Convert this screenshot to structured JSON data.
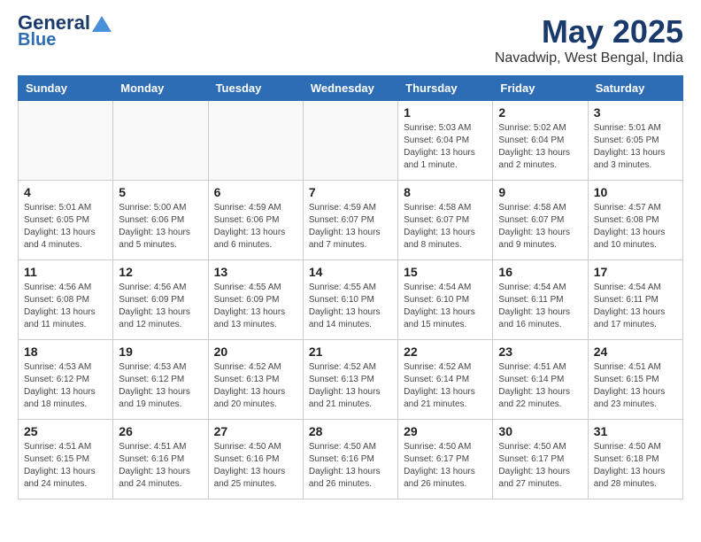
{
  "header": {
    "logo_general": "General",
    "logo_blue": "Blue",
    "month_title": "May 2025",
    "location": "Navadwip, West Bengal, India"
  },
  "days_of_week": [
    "Sunday",
    "Monday",
    "Tuesday",
    "Wednesday",
    "Thursday",
    "Friday",
    "Saturday"
  ],
  "weeks": [
    [
      {
        "num": "",
        "info": ""
      },
      {
        "num": "",
        "info": ""
      },
      {
        "num": "",
        "info": ""
      },
      {
        "num": "",
        "info": ""
      },
      {
        "num": "1",
        "info": "Sunrise: 5:03 AM\nSunset: 6:04 PM\nDaylight: 13 hours\nand 1 minute."
      },
      {
        "num": "2",
        "info": "Sunrise: 5:02 AM\nSunset: 6:04 PM\nDaylight: 13 hours\nand 2 minutes."
      },
      {
        "num": "3",
        "info": "Sunrise: 5:01 AM\nSunset: 6:05 PM\nDaylight: 13 hours\nand 3 minutes."
      }
    ],
    [
      {
        "num": "4",
        "info": "Sunrise: 5:01 AM\nSunset: 6:05 PM\nDaylight: 13 hours\nand 4 minutes."
      },
      {
        "num": "5",
        "info": "Sunrise: 5:00 AM\nSunset: 6:06 PM\nDaylight: 13 hours\nand 5 minutes."
      },
      {
        "num": "6",
        "info": "Sunrise: 4:59 AM\nSunset: 6:06 PM\nDaylight: 13 hours\nand 6 minutes."
      },
      {
        "num": "7",
        "info": "Sunrise: 4:59 AM\nSunset: 6:07 PM\nDaylight: 13 hours\nand 7 minutes."
      },
      {
        "num": "8",
        "info": "Sunrise: 4:58 AM\nSunset: 6:07 PM\nDaylight: 13 hours\nand 8 minutes."
      },
      {
        "num": "9",
        "info": "Sunrise: 4:58 AM\nSunset: 6:07 PM\nDaylight: 13 hours\nand 9 minutes."
      },
      {
        "num": "10",
        "info": "Sunrise: 4:57 AM\nSunset: 6:08 PM\nDaylight: 13 hours\nand 10 minutes."
      }
    ],
    [
      {
        "num": "11",
        "info": "Sunrise: 4:56 AM\nSunset: 6:08 PM\nDaylight: 13 hours\nand 11 minutes."
      },
      {
        "num": "12",
        "info": "Sunrise: 4:56 AM\nSunset: 6:09 PM\nDaylight: 13 hours\nand 12 minutes."
      },
      {
        "num": "13",
        "info": "Sunrise: 4:55 AM\nSunset: 6:09 PM\nDaylight: 13 hours\nand 13 minutes."
      },
      {
        "num": "14",
        "info": "Sunrise: 4:55 AM\nSunset: 6:10 PM\nDaylight: 13 hours\nand 14 minutes."
      },
      {
        "num": "15",
        "info": "Sunrise: 4:54 AM\nSunset: 6:10 PM\nDaylight: 13 hours\nand 15 minutes."
      },
      {
        "num": "16",
        "info": "Sunrise: 4:54 AM\nSunset: 6:11 PM\nDaylight: 13 hours\nand 16 minutes."
      },
      {
        "num": "17",
        "info": "Sunrise: 4:54 AM\nSunset: 6:11 PM\nDaylight: 13 hours\nand 17 minutes."
      }
    ],
    [
      {
        "num": "18",
        "info": "Sunrise: 4:53 AM\nSunset: 6:12 PM\nDaylight: 13 hours\nand 18 minutes."
      },
      {
        "num": "19",
        "info": "Sunrise: 4:53 AM\nSunset: 6:12 PM\nDaylight: 13 hours\nand 19 minutes."
      },
      {
        "num": "20",
        "info": "Sunrise: 4:52 AM\nSunset: 6:13 PM\nDaylight: 13 hours\nand 20 minutes."
      },
      {
        "num": "21",
        "info": "Sunrise: 4:52 AM\nSunset: 6:13 PM\nDaylight: 13 hours\nand 21 minutes."
      },
      {
        "num": "22",
        "info": "Sunrise: 4:52 AM\nSunset: 6:14 PM\nDaylight: 13 hours\nand 21 minutes."
      },
      {
        "num": "23",
        "info": "Sunrise: 4:51 AM\nSunset: 6:14 PM\nDaylight: 13 hours\nand 22 minutes."
      },
      {
        "num": "24",
        "info": "Sunrise: 4:51 AM\nSunset: 6:15 PM\nDaylight: 13 hours\nand 23 minutes."
      }
    ],
    [
      {
        "num": "25",
        "info": "Sunrise: 4:51 AM\nSunset: 6:15 PM\nDaylight: 13 hours\nand 24 minutes."
      },
      {
        "num": "26",
        "info": "Sunrise: 4:51 AM\nSunset: 6:16 PM\nDaylight: 13 hours\nand 24 minutes."
      },
      {
        "num": "27",
        "info": "Sunrise: 4:50 AM\nSunset: 6:16 PM\nDaylight: 13 hours\nand 25 minutes."
      },
      {
        "num": "28",
        "info": "Sunrise: 4:50 AM\nSunset: 6:16 PM\nDaylight: 13 hours\nand 26 minutes."
      },
      {
        "num": "29",
        "info": "Sunrise: 4:50 AM\nSunset: 6:17 PM\nDaylight: 13 hours\nand 26 minutes."
      },
      {
        "num": "30",
        "info": "Sunrise: 4:50 AM\nSunset: 6:17 PM\nDaylight: 13 hours\nand 27 minutes."
      },
      {
        "num": "31",
        "info": "Sunrise: 4:50 AM\nSunset: 6:18 PM\nDaylight: 13 hours\nand 28 minutes."
      }
    ]
  ]
}
